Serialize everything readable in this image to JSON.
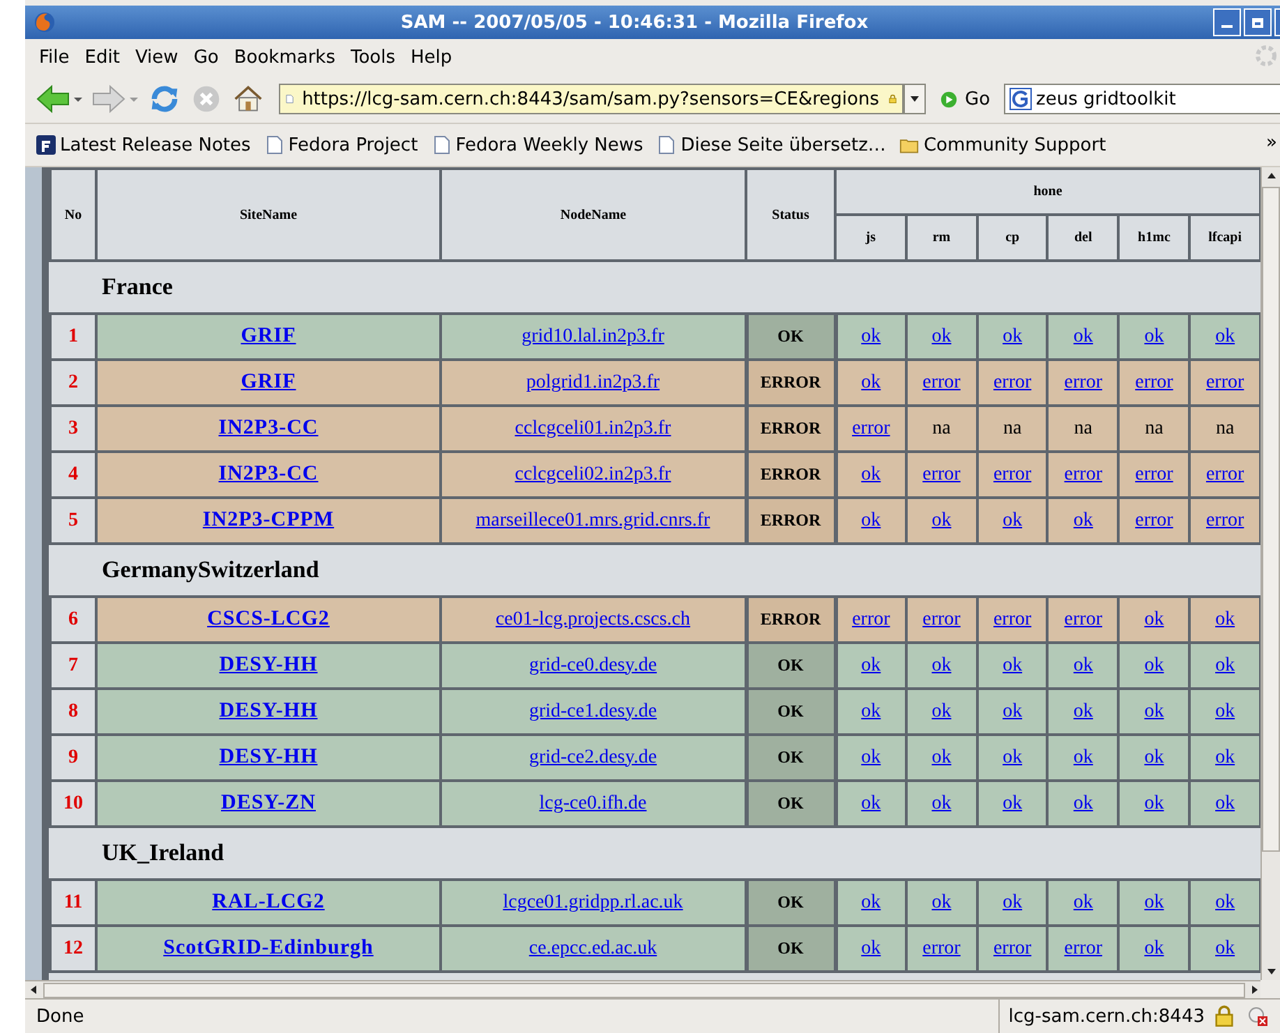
{
  "window": {
    "title": "SAM -- 2007/05/05 - 10:46:31 - Mozilla Firefox"
  },
  "menu": [
    {
      "label": "File"
    },
    {
      "label": "Edit"
    },
    {
      "label": "View"
    },
    {
      "label": "Go"
    },
    {
      "label": "Bookmarks"
    },
    {
      "label": "Tools"
    },
    {
      "label": "Help"
    }
  ],
  "toolbar": {
    "url": "https://lcg-sam.cern.ch:8443/sam/sam.py?sensors=CE&regions",
    "go": "Go",
    "search": "zeus gridtoolkit"
  },
  "bookmarks": [
    {
      "label": "Latest Release Notes",
      "kind": "fedora"
    },
    {
      "label": "Fedora Project",
      "kind": "page"
    },
    {
      "label": "Fedora Weekly News",
      "kind": "page"
    },
    {
      "label": "Diese Seite übersetz…",
      "kind": "page"
    },
    {
      "label": "Community Support",
      "kind": "folder"
    }
  ],
  "bookmarks_more": "»",
  "table": {
    "columns": [
      "No",
      "SiteName",
      "NodeName",
      "Status"
    ],
    "group": "hone",
    "tests": [
      "js",
      "rm",
      "cp",
      "del",
      "h1mc",
      "lfcapi"
    ],
    "sections": [
      {
        "name": "France",
        "rows": [
          {
            "no": "1",
            "site": "GRIF",
            "node": "grid10.lal.in2p3.fr",
            "status": "OK",
            "kind": "ok",
            "results": [
              {
                "text": "ok",
                "link": true
              },
              {
                "text": "ok",
                "link": true
              },
              {
                "text": "ok",
                "link": true
              },
              {
                "text": "ok",
                "link": true
              },
              {
                "text": "ok",
                "link": true
              },
              {
                "text": "ok",
                "link": true
              }
            ]
          },
          {
            "no": "2",
            "site": "GRIF",
            "node": "polgrid1.in2p3.fr",
            "status": "ERROR",
            "kind": "error",
            "results": [
              {
                "text": "ok",
                "link": true
              },
              {
                "text": "error",
                "link": true
              },
              {
                "text": "error",
                "link": true
              },
              {
                "text": "error",
                "link": true
              },
              {
                "text": "error",
                "link": true
              },
              {
                "text": "error",
                "link": true
              }
            ]
          },
          {
            "no": "3",
            "site": "IN2P3-CC",
            "node": "cclcgceli01.in2p3.fr",
            "status": "ERROR",
            "kind": "error",
            "results": [
              {
                "text": "error",
                "link": true
              },
              {
                "text": "na",
                "link": false
              },
              {
                "text": "na",
                "link": false
              },
              {
                "text": "na",
                "link": false
              },
              {
                "text": "na",
                "link": false
              },
              {
                "text": "na",
                "link": false
              }
            ]
          },
          {
            "no": "4",
            "site": "IN2P3-CC",
            "node": "cclcgceli02.in2p3.fr",
            "status": "ERROR",
            "kind": "error",
            "results": [
              {
                "text": "ok",
                "link": true
              },
              {
                "text": "error",
                "link": true
              },
              {
                "text": "error",
                "link": true
              },
              {
                "text": "error",
                "link": true
              },
              {
                "text": "error",
                "link": true
              },
              {
                "text": "error",
                "link": true
              }
            ]
          },
          {
            "no": "5",
            "site": "IN2P3-CPPM",
            "node": "marseillece01.mrs.grid.cnrs.fr",
            "status": "ERROR",
            "kind": "error",
            "results": [
              {
                "text": "ok",
                "link": true
              },
              {
                "text": "ok",
                "link": true
              },
              {
                "text": "ok",
                "link": true
              },
              {
                "text": "ok",
                "link": true
              },
              {
                "text": "error",
                "link": true
              },
              {
                "text": "error",
                "link": true
              }
            ]
          }
        ]
      },
      {
        "name": "GermanySwitzerland",
        "rows": [
          {
            "no": "6",
            "site": "CSCS-LCG2",
            "node": "ce01-lcg.projects.cscs.ch",
            "status": "ERROR",
            "kind": "error",
            "results": [
              {
                "text": "error",
                "link": true
              },
              {
                "text": "error",
                "link": true
              },
              {
                "text": "error",
                "link": true
              },
              {
                "text": "error",
                "link": true
              },
              {
                "text": "ok",
                "link": true
              },
              {
                "text": "ok",
                "link": true
              }
            ]
          },
          {
            "no": "7",
            "site": "DESY-HH",
            "node": "grid-ce0.desy.de",
            "status": "OK",
            "kind": "ok",
            "results": [
              {
                "text": "ok",
                "link": true
              },
              {
                "text": "ok",
                "link": true
              },
              {
                "text": "ok",
                "link": true
              },
              {
                "text": "ok",
                "link": true
              },
              {
                "text": "ok",
                "link": true
              },
              {
                "text": "ok",
                "link": true
              }
            ]
          },
          {
            "no": "8",
            "site": "DESY-HH",
            "node": "grid-ce1.desy.de",
            "status": "OK",
            "kind": "ok",
            "results": [
              {
                "text": "ok",
                "link": true
              },
              {
                "text": "ok",
                "link": true
              },
              {
                "text": "ok",
                "link": true
              },
              {
                "text": "ok",
                "link": true
              },
              {
                "text": "ok",
                "link": true
              },
              {
                "text": "ok",
                "link": true
              }
            ]
          },
          {
            "no": "9",
            "site": "DESY-HH",
            "node": "grid-ce2.desy.de",
            "status": "OK",
            "kind": "ok",
            "results": [
              {
                "text": "ok",
                "link": true
              },
              {
                "text": "ok",
                "link": true
              },
              {
                "text": "ok",
                "link": true
              },
              {
                "text": "ok",
                "link": true
              },
              {
                "text": "ok",
                "link": true
              },
              {
                "text": "ok",
                "link": true
              }
            ]
          },
          {
            "no": "10",
            "site": "DESY-ZN",
            "node": "lcg-ce0.ifh.de",
            "status": "OK",
            "kind": "ok",
            "results": [
              {
                "text": "ok",
                "link": true
              },
              {
                "text": "ok",
                "link": true
              },
              {
                "text": "ok",
                "link": true
              },
              {
                "text": "ok",
                "link": true
              },
              {
                "text": "ok",
                "link": true
              },
              {
                "text": "ok",
                "link": true
              }
            ]
          }
        ]
      },
      {
        "name": "UK_Ireland",
        "rows": [
          {
            "no": "11",
            "site": "RAL-LCG2",
            "node": "lcgce01.gridpp.rl.ac.uk",
            "status": "OK",
            "kind": "ok",
            "results": [
              {
                "text": "ok",
                "link": true
              },
              {
                "text": "ok",
                "link": true
              },
              {
                "text": "ok",
                "link": true
              },
              {
                "text": "ok",
                "link": true
              },
              {
                "text": "ok",
                "link": true
              },
              {
                "text": "ok",
                "link": true
              }
            ]
          },
          {
            "no": "12",
            "site": "ScotGRID-Edinburgh",
            "node": "ce.epcc.ed.ac.uk",
            "status": "OK",
            "kind": "ok",
            "results": [
              {
                "text": "ok",
                "link": true
              },
              {
                "text": "error",
                "link": true
              },
              {
                "text": "error",
                "link": true
              },
              {
                "text": "error",
                "link": true
              },
              {
                "text": "ok",
                "link": true
              },
              {
                "text": "ok",
                "link": true
              }
            ]
          }
        ]
      }
    ]
  },
  "status_bar": {
    "text": "Done",
    "host": "lcg-sam.cern.ch:8443"
  }
}
